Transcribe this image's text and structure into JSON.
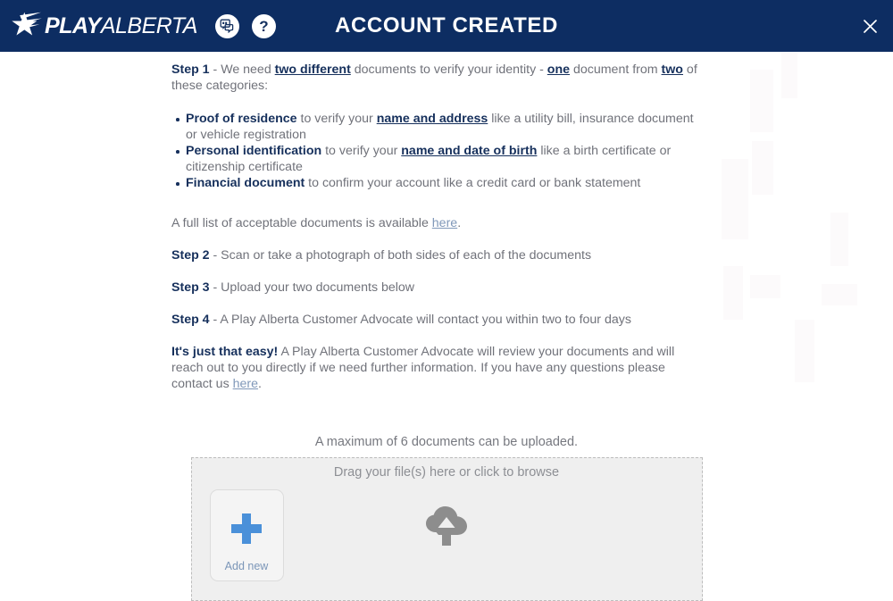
{
  "header": {
    "logo_play": "PLAY",
    "logo_alberta": "ALBERTA",
    "logo_star_icon": "star-logo-icon",
    "chat_icon": "chat-bubble-icon",
    "help_icon": "question-mark-icon",
    "help_label": "?",
    "title": "ACCOUNT CREATED",
    "close_icon": "close-icon",
    "background_color": "#0d2d62"
  },
  "content": {
    "step1": {
      "label": "Step 1",
      "dash": " - ",
      "t1": "We need ",
      "bold1": "two different",
      "t2": " documents to verify your identity - ",
      "bold2": "one",
      "t3": " document from ",
      "bold3": "two",
      "t4": " of these categories:"
    },
    "categories": [
      {
        "bold": "Proof of residence",
        "mid": " to verify your ",
        "underline": "name and address",
        "tail": " like a utility bill, insurance document or vehicle registration"
      },
      {
        "bold": "Personal identification",
        "mid": " to verify your ",
        "underline": "name and date of birth",
        "tail": " like a birth certificate or citizenship certificate"
      },
      {
        "bold": "Financial document",
        "mid": " to confirm your account like a credit card or bank statement",
        "underline": "",
        "tail": ""
      }
    ],
    "full_list": {
      "pre": "A full list of acceptable documents is available ",
      "link": "here",
      "post": "."
    },
    "step2": {
      "label": "Step 2",
      "text": " - Scan or take a photograph of both sides of each of the documents"
    },
    "step3": {
      "label": "Step 3",
      "text": " - Upload your two documents below"
    },
    "step4": {
      "label": "Step 4",
      "text": " - A Play Alberta Customer Advocate will contact you within two to four days"
    },
    "closing": {
      "bold": "It's just that easy!",
      "text": " A Play Alberta Customer Advocate will review your documents and will reach out to you directly if we need further information. If you have any questions please contact us ",
      "link": "here",
      "post": "."
    }
  },
  "upload": {
    "max_note": "A maximum of 6 documents can be uploaded.",
    "drop_label": "Drag your file(s) here or click to browse",
    "add_new_label": "Add new",
    "plus_icon": "plus-icon",
    "cloud_icon": "cloud-upload-icon",
    "accent_color": "#4a90d9"
  }
}
